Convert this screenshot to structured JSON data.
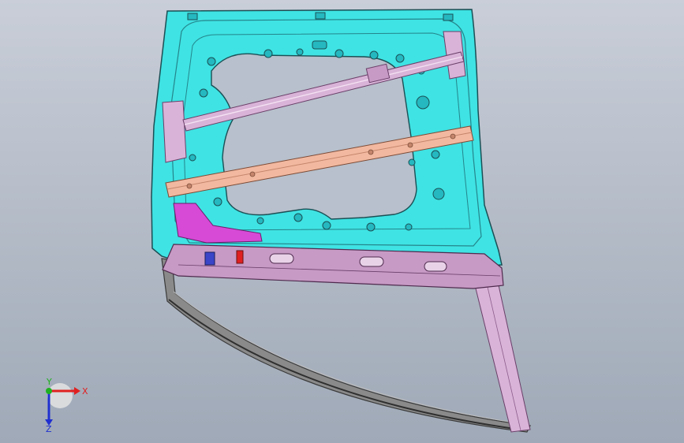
{
  "viewport": {
    "background_top": "#c9ced8",
    "background_bottom": "#9fa9b7"
  },
  "model": {
    "part_name": "door-inner-panel",
    "colors": {
      "inner_panel": "#3fe3e3",
      "inner_panel_dark": "#25b8c0",
      "outline": "#1b4f55",
      "reinforcement": "#f2b9a0",
      "bar": "#d9b4d8",
      "lower_beam": "#c69ac4",
      "magenta_part": "#d64ad6",
      "frame": "#6a6a6a",
      "bracket_blue": "#3a45c8"
    }
  },
  "triad": {
    "x_label": "X",
    "y_label": "Y",
    "z_label": "Z",
    "x_color": "#e02020",
    "y_color": "#20b020",
    "z_color": "#2030d0"
  }
}
